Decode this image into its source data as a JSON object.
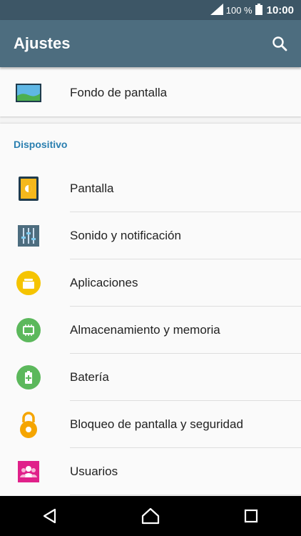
{
  "status_bar": {
    "battery_percent": "100 %",
    "time": "10:00"
  },
  "app_bar": {
    "title": "Ajustes"
  },
  "top_item": {
    "label": "Fondo de pantalla"
  },
  "section": {
    "header": "Dispositivo"
  },
  "items": [
    {
      "label": "Pantalla",
      "icon": "display-icon"
    },
    {
      "label": "Sonido y notificación",
      "icon": "sound-icon"
    },
    {
      "label": "Aplicaciones",
      "icon": "apps-icon"
    },
    {
      "label": "Almacenamiento y memoria",
      "icon": "storage-icon"
    },
    {
      "label": "Batería",
      "icon": "battery-icon"
    },
    {
      "label": "Bloqueo de pantalla y seguridad",
      "icon": "lock-icon"
    },
    {
      "label": "Usuarios",
      "icon": "users-icon"
    }
  ],
  "colors": {
    "app_bar": "#4d6d7f",
    "status_bar": "#3d5666",
    "section_header": "#2a7fb0"
  }
}
